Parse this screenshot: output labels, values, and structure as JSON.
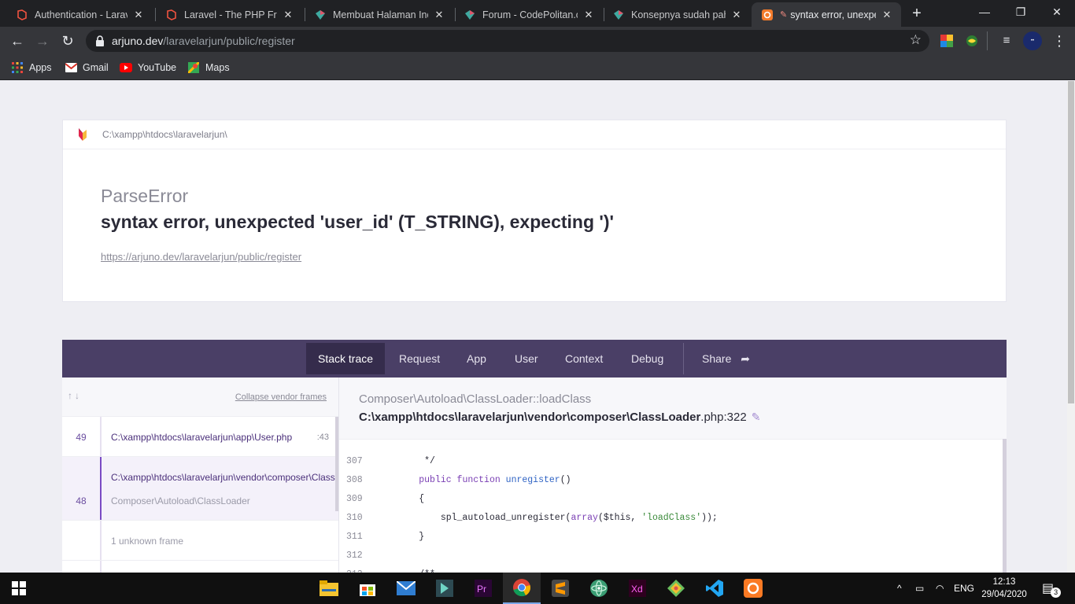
{
  "browser": {
    "tabs": [
      {
        "title": "Authentication - Laravel",
        "icon": "laravel-icon"
      },
      {
        "title": "Laravel - The PHP Framework",
        "icon": "laravel-icon"
      },
      {
        "title": "Membuat Halaman Index",
        "icon": "codepolitan-icon"
      },
      {
        "title": "Forum - CodePolitan.com",
        "icon": "codepolitan-icon"
      },
      {
        "title": "Konsepnya sudah paham",
        "icon": "codepolitan-icon"
      },
      {
        "title": "syntax error, unexpected",
        "icon": "ignition-icon"
      }
    ],
    "active_tab": 5,
    "url_host": "arjuno.dev",
    "url_path": "/laravelarjun/public/register",
    "bookmarks": [
      "Apps",
      "Gmail",
      "YouTube",
      "Maps"
    ]
  },
  "error": {
    "root_path": "C:\\xampp\\htdocs\\laravelarjun\\",
    "class": "ParseError",
    "message": "syntax error, unexpected 'user_id' (T_STRING), expecting ')'",
    "url": "https://arjuno.dev/laravelarjun/public/register"
  },
  "nav": {
    "tabs": [
      "Stack trace",
      "Request",
      "App",
      "User",
      "Context",
      "Debug"
    ],
    "share": "Share",
    "active": "Stack trace"
  },
  "stack": {
    "collapse_label": "Collapse vendor frames",
    "frames": [
      {
        "num": "49",
        "file": "C:\\xampp\\htdocs\\laravelarjun\\app\\User.php",
        "line": ":43",
        "cls": ""
      },
      {
        "num": "48",
        "file": "C:\\xampp\\htdocs\\laravelarjun\\vendor\\composer\\ClassLoader.php",
        "line": "",
        "cls": "Composer\\Autoload\\ClassLoader"
      },
      {
        "num": "",
        "file": "",
        "line": "",
        "cls": "1 unknown frame"
      }
    ]
  },
  "code_panel": {
    "class": "Composer\\Autoload\\ClassLoader::loadClass",
    "file": "C:\\xampp\\htdocs\\laravelarjun\\vendor\\composer\\ClassLoader",
    "file_ext": ".php:322",
    "lines": [
      {
        "n": "307",
        "text": "         */"
      },
      {
        "n": "308",
        "text": "        public function unregister()"
      },
      {
        "n": "309",
        "text": "        {"
      },
      {
        "n": "310",
        "text": "            spl_autoload_unregister(array($this, 'loadClass'));"
      },
      {
        "n": "311",
        "text": "        }"
      },
      {
        "n": "312",
        "text": ""
      },
      {
        "n": "313",
        "text": "        /**"
      }
    ]
  },
  "taskbar": {
    "lang": "ENG",
    "time": "12:13",
    "date": "29/04/2020",
    "notifications": "3"
  },
  "colors": {
    "ignition_nav": "#4a3f66",
    "ignition_nav_active": "#352c4c",
    "accent_purple": "#7a4bc4"
  }
}
